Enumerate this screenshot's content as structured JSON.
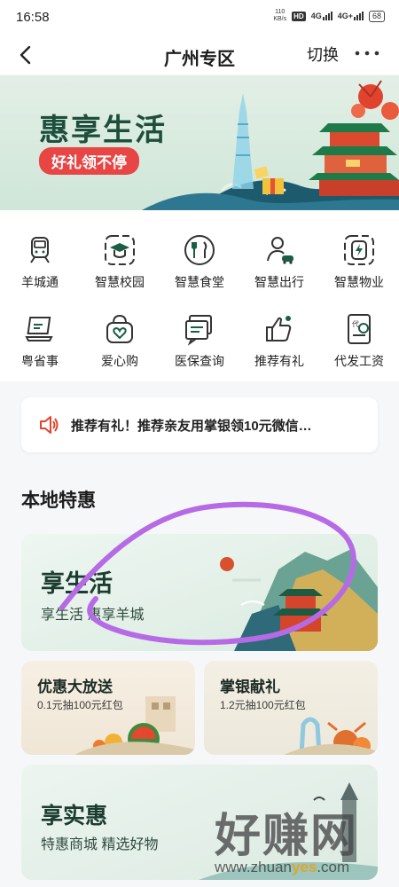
{
  "status_bar": {
    "time": "16:58",
    "net_speed_value": "110",
    "net_speed_unit": "KB/s",
    "hd": "HD",
    "sim1": "4G",
    "sim2": "4G+",
    "battery": "68"
  },
  "nav": {
    "title": "广州专区",
    "switch_label": "切换",
    "back_icon": "chevron-left-icon",
    "more_icon": "more-dots-icon"
  },
  "banner": {
    "title": "惠享生活",
    "tag": "好礼领不停"
  },
  "services": [
    {
      "label": "羊城通",
      "icon": "train-icon"
    },
    {
      "label": "智慧校园",
      "icon": "graduation-cap-icon"
    },
    {
      "label": "智慧食堂",
      "icon": "fork-knife-icon"
    },
    {
      "label": "智慧出行",
      "icon": "person-car-icon"
    },
    {
      "label": "智慧物业",
      "icon": "lightning-home-icon"
    },
    {
      "label": "粤省事",
      "icon": "laptop-icon"
    },
    {
      "label": "爱心购",
      "icon": "heart-bag-icon"
    },
    {
      "label": "医保查询",
      "icon": "message-list-icon"
    },
    {
      "label": "推荐有礼",
      "icon": "thumbs-up-icon"
    },
    {
      "label": "代发工资",
      "icon": "payroll-icon"
    }
  ],
  "notice": {
    "text": "推荐有礼！推荐亲友用掌银领10元微信…",
    "icon": "speaker-icon"
  },
  "section": {
    "title": "本地特惠"
  },
  "cards": {
    "life": {
      "title": "享生活",
      "subtitle": "享生活 惠享羊城"
    },
    "discount": {
      "title": "优惠大放送",
      "subtitle": "0.1元抽100元红包"
    },
    "gift": {
      "title": "掌银献礼",
      "subtitle": "1.2元抽100元红包"
    },
    "real": {
      "title": "享实惠",
      "subtitle": "特惠商城 精选好物"
    }
  },
  "watermark": {
    "text": "好赚网",
    "url_pre": "www.zhuan",
    "url_hl": "yes",
    "url_post": ".com"
  },
  "colors": {
    "accent_green": "#1b5e45",
    "tag_red": "#e84545",
    "annotation_purple": "#b66ae6"
  }
}
